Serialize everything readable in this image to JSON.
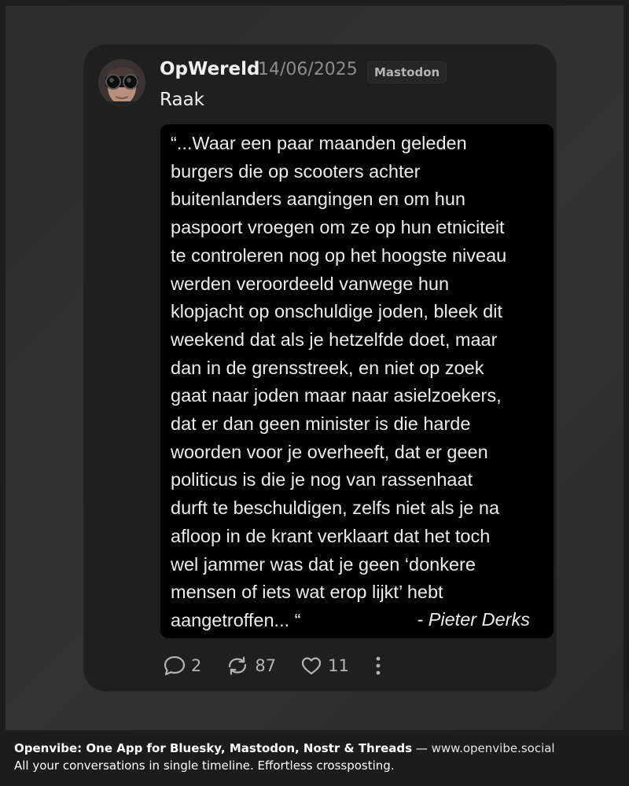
{
  "post": {
    "author": "OpWereld",
    "date": "14/06/2025",
    "network": "Mastodon",
    "text": "Raak",
    "image_quote": {
      "lines": [
        "“...Waar een paar maanden geleden",
        "burgers die op scooters achter",
        "buitenlanders aangingen en om hun",
        "paspoort vroegen om ze op hun etniciteit",
        "te controleren nog op het hoogste niveau",
        "werden veroordeeld vanwege hun",
        "klopjacht op onschuldige joden, bleek dit",
        "weekend dat als je hetzelfde doet, maar",
        "dan in de grensstreek, en niet op zoek",
        "gaat naar joden maar naar asielzoekers,",
        "dat er dan geen minister is die harde",
        "woorden voor je overheeft, dat er geen",
        "politicus is die je nog van rassenhaat",
        "durft te beschuldigen, zelfs niet als je na",
        "afloop in de krant verklaart dat het toch",
        "wel jammer was dat je geen ‘donkere",
        "mensen of iets wat erop lijkt’ hebt",
        "aangetroffen... “"
      ],
      "attribution": "- Pieter Derks"
    },
    "stats": {
      "replies": "2",
      "reposts": "87",
      "likes": "11"
    },
    "icons": [
      "avatar",
      "reply-icon",
      "repost-icon",
      "like-icon",
      "more-icon"
    ]
  },
  "footer": {
    "headline": "Openvibe: One App for Bluesky, Mastodon, Nostr & Threads",
    "separator": " — ",
    "site": "www.openvibe.social",
    "tagline": "All your conversations in single timeline. Effortless crossposting."
  },
  "colors": {
    "background": "#1c1c1c",
    "card": "#1f1f1f",
    "text": "#f1f1f1",
    "muted": "#8c8c8c"
  }
}
